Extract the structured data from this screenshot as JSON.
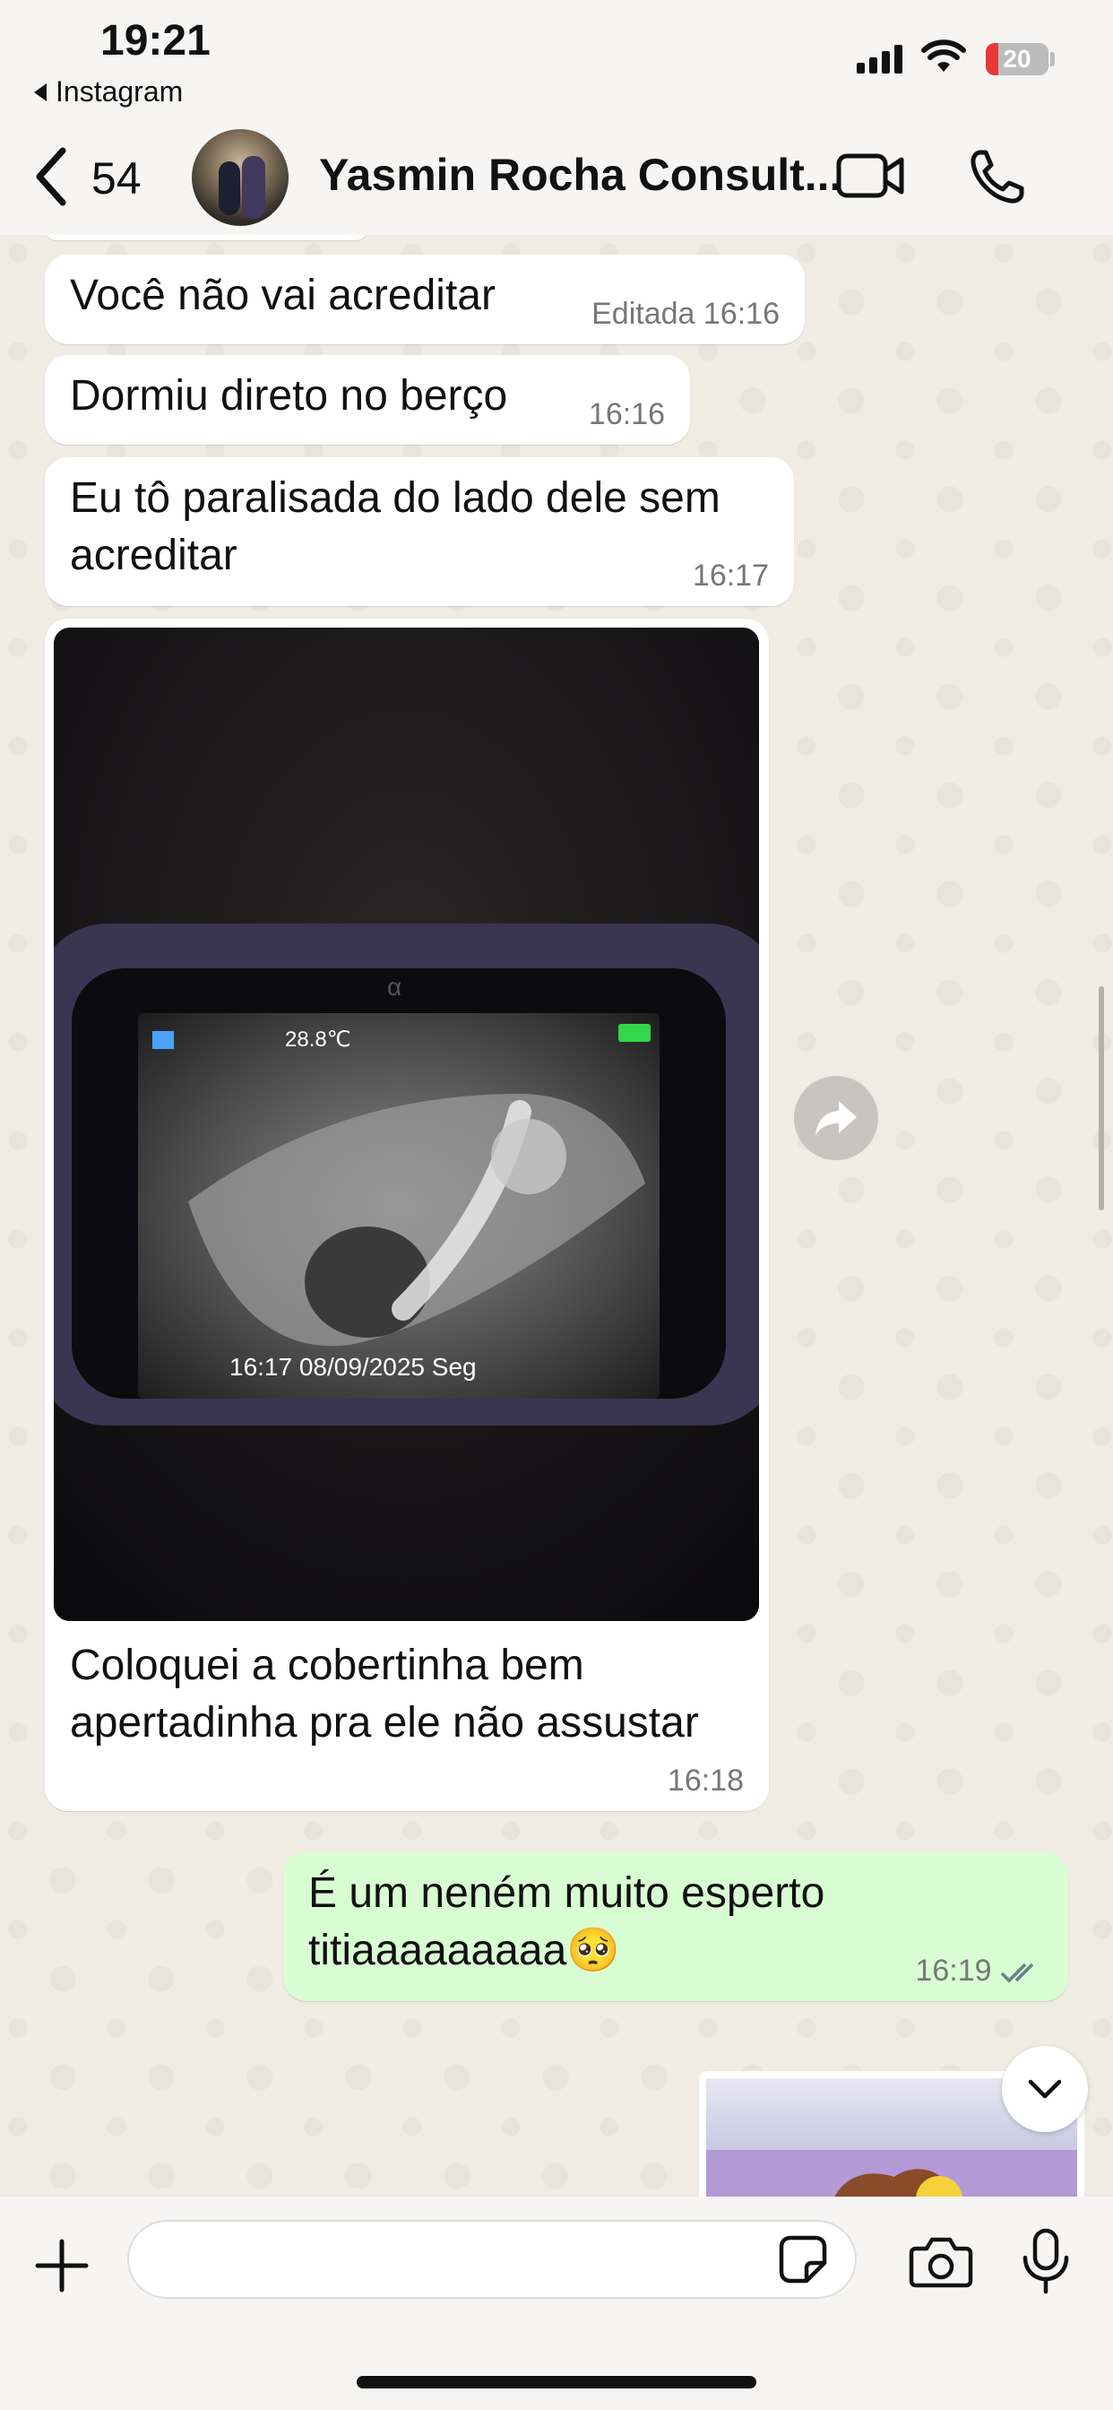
{
  "status_bar": {
    "time": "19:21",
    "back_app": "Instagram",
    "battery_level": "20",
    "battery_color": "#e53935"
  },
  "header": {
    "back_icon": "chevron-left-icon",
    "unread_count": "54",
    "contact_name": "Yasmin Rocha Consult...",
    "video_icon": "video-camera-icon",
    "call_icon": "phone-icon"
  },
  "messages": [
    {
      "direction": "in",
      "text": "Você não vai acreditar",
      "edited_label": "Editada",
      "time": "16:16"
    },
    {
      "direction": "in",
      "text": "Dormiu direto no berço",
      "time": "16:16"
    },
    {
      "direction": "in",
      "text_line1": "Eu tô paralisada do lado dele sem",
      "text_line2": "acreditar",
      "time": "16:17"
    },
    {
      "direction": "in",
      "type": "image",
      "image_overlay": {
        "temperature": "28.8℃",
        "timestamp": "16:17  08/09/2025 Seg",
        "brand_mark": "α"
      },
      "caption_line1": "Coloquei a cobertinha bem",
      "caption_line2": "apertadinha pra ele não assustar",
      "time": "16:18"
    },
    {
      "direction": "out",
      "text_line1": "É um neném muito esperto",
      "text_line2": "titiaaaaaaaaa🥺",
      "time": "16:19",
      "status": "read"
    }
  ],
  "colors": {
    "outgoing_bubble": "#d9fdd3",
    "incoming_bubble": "#ffffff",
    "wallpaper": "#f0ebe3",
    "read_ticks": "#6b7f86"
  },
  "input_bar": {
    "add_icon": "plus-icon",
    "sticker_icon": "sticker-icon",
    "camera_icon": "camera-icon",
    "mic_icon": "microphone-icon"
  }
}
